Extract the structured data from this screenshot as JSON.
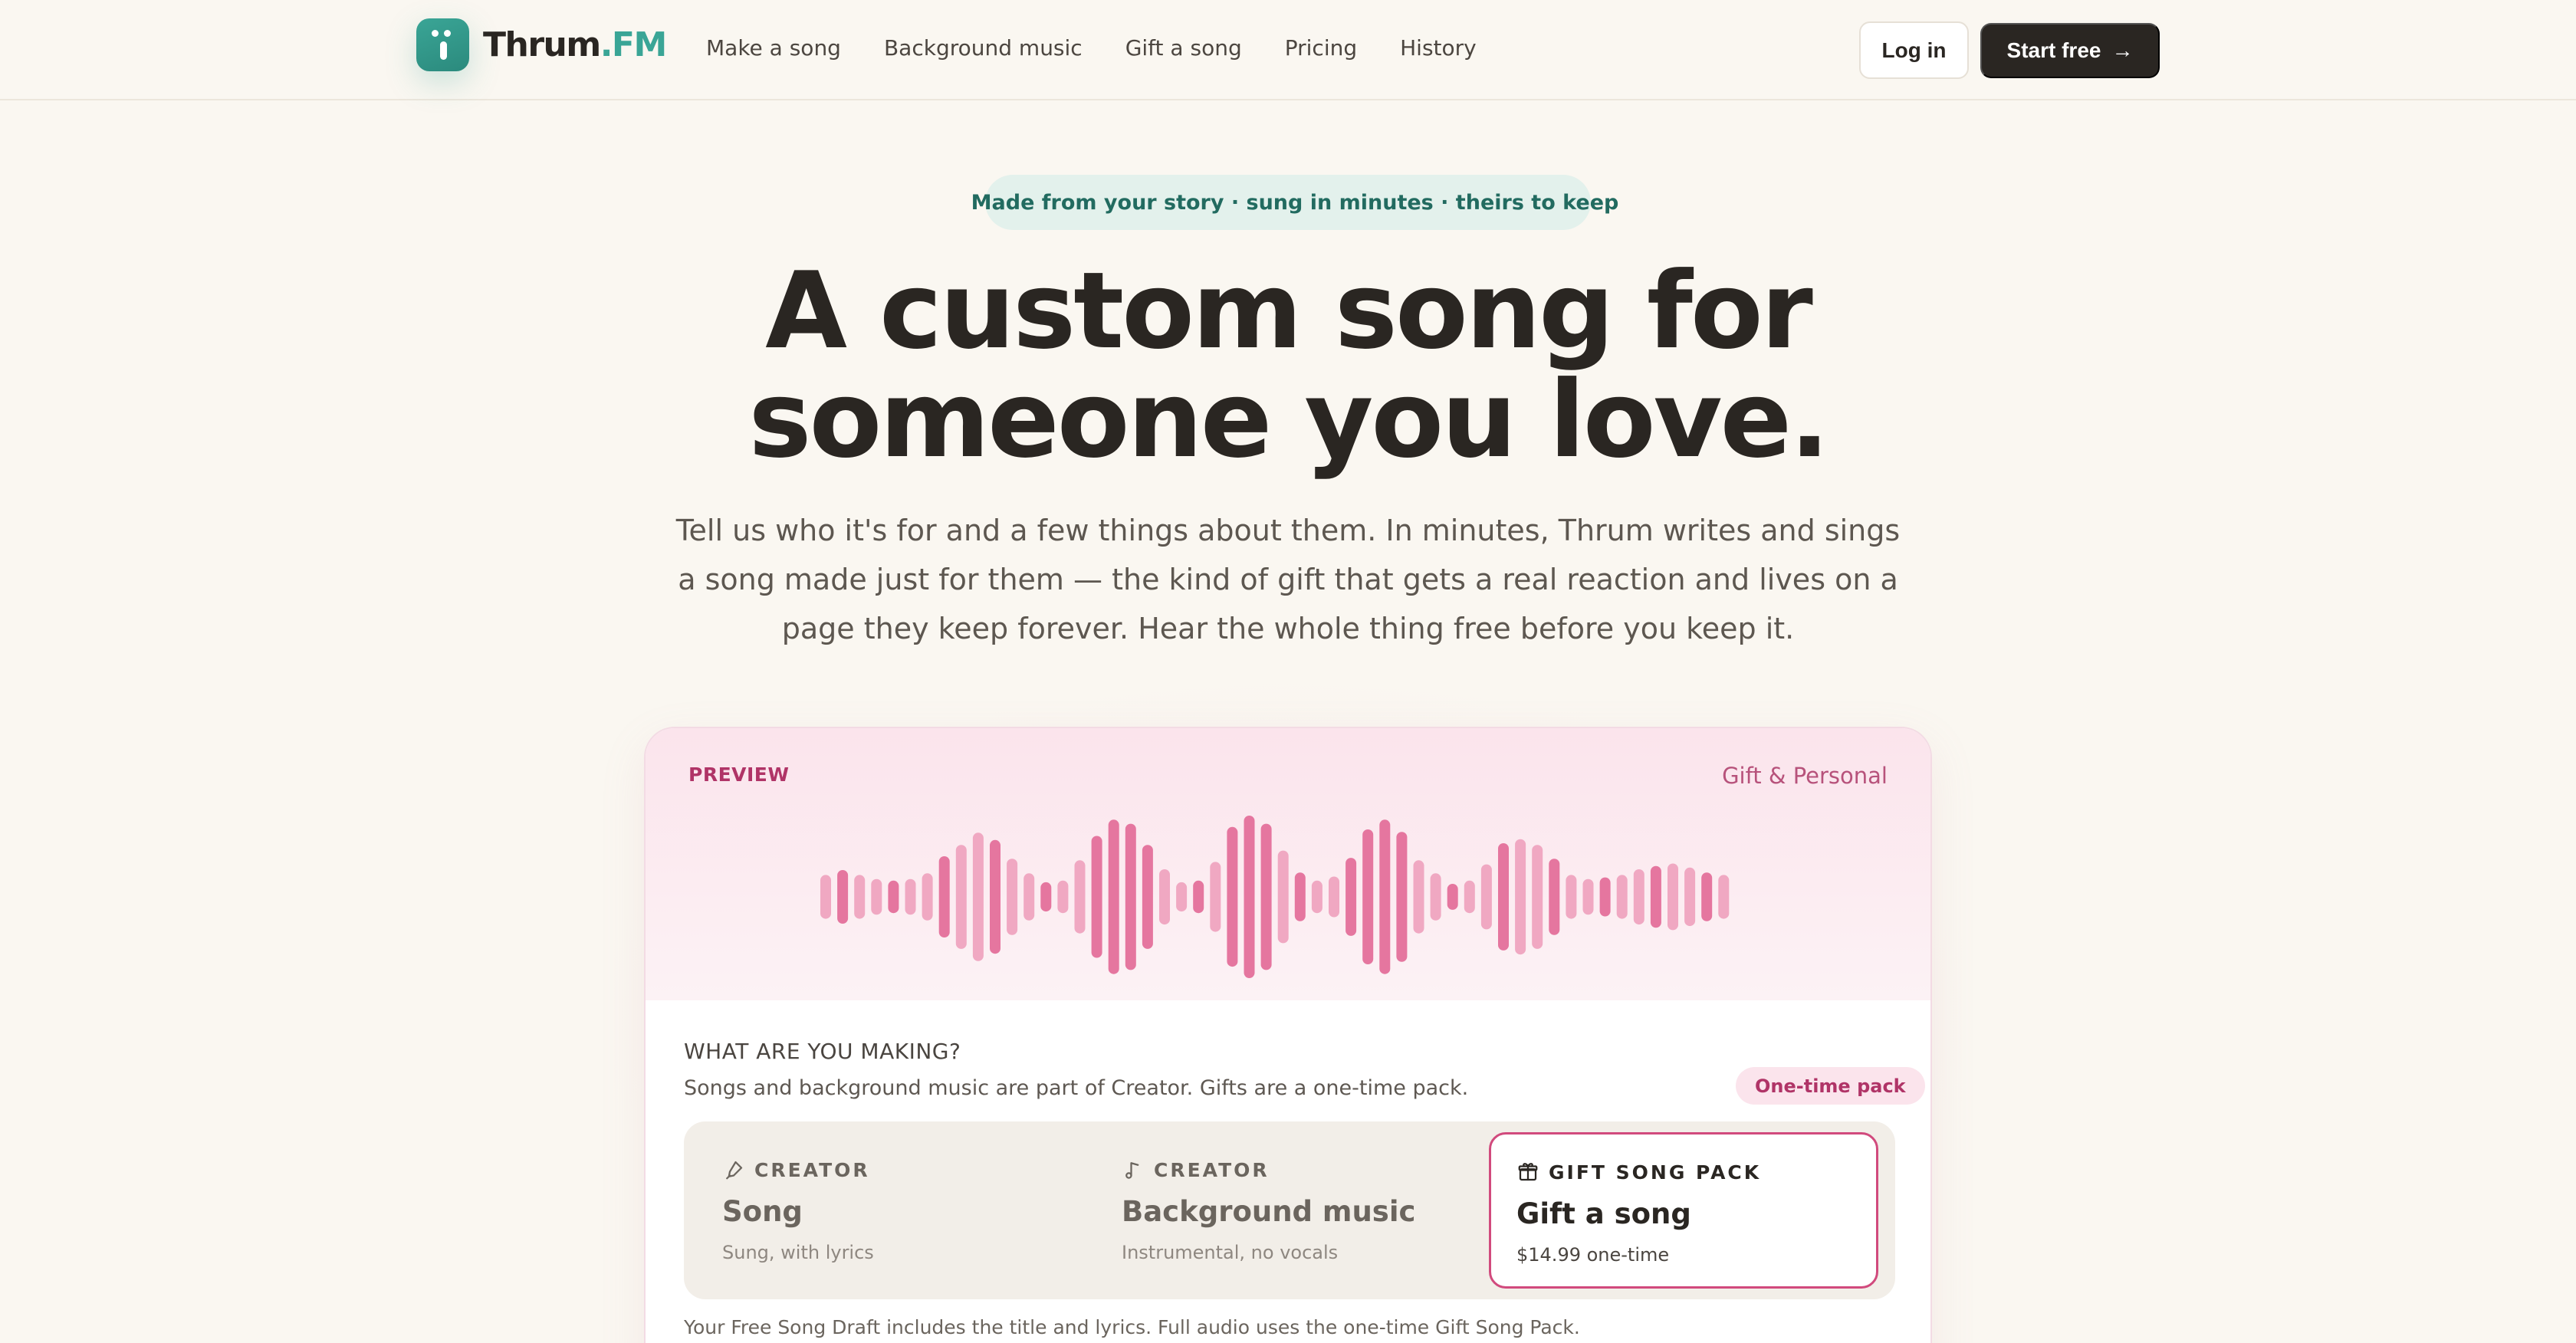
{
  "nav": {
    "brand_main": "Thrum",
    "brand_suffix": ".FM",
    "links": [
      "Make a song",
      "Background music",
      "Gift a song",
      "Pricing",
      "History"
    ],
    "login_label": "Log in",
    "start_label": "Start free"
  },
  "hero": {
    "pill_text": "Made from your story · sung in minutes · theirs to keep",
    "headline_line1": "A custom song for",
    "headline_line2": "someone you love.",
    "subtext": "Tell us who it's for and a few things about them. In minutes, Thrum writes and sings a song made just for them — the kind of gift that gets a real reaction and lives on a page they keep forever. Hear the whole thing free before you keep it."
  },
  "card": {
    "preview_label": "PREVIEW",
    "category_label": "Gift & Personal",
    "waveform": {
      "colors": [
        "#f0a8c2",
        "#e5769f"
      ],
      "levels": [
        0.27,
        0.33,
        0.27,
        0.22,
        0.2,
        0.22,
        0.29,
        0.5,
        0.64,
        0.79,
        0.7,
        0.47,
        0.29,
        0.18,
        0.2,
        0.45,
        0.75,
        0.95,
        0.9,
        0.64,
        0.34,
        0.18,
        0.2,
        0.43,
        0.86,
        1.0,
        0.9,
        0.57,
        0.3,
        0.2,
        0.25,
        0.48,
        0.83,
        0.95,
        0.8,
        0.45,
        0.29,
        0.16,
        0.2,
        0.4,
        0.66,
        0.71,
        0.64,
        0.47,
        0.27,
        0.22,
        0.24,
        0.27,
        0.34,
        0.38,
        0.41,
        0.36,
        0.3,
        0.27
      ]
    },
    "making_title": "WHAT ARE YOU MAKING?",
    "making_sub": "Songs and background music are part of Creator. Gifts are a one-time pack.",
    "badge": "One-time pack",
    "options": [
      {
        "kicker": "CREATOR",
        "title": "Song",
        "desc": "Sung, with lyrics",
        "icon": "microphone-icon"
      },
      {
        "kicker": "CREATOR",
        "title": "Background music",
        "desc": "Instrumental, no vocals",
        "icon": "music-note-icon"
      },
      {
        "kicker": "GIFT SONG PACK",
        "title": "Gift a song",
        "desc": "$14.99 one-time",
        "icon": "gift-icon"
      }
    ],
    "footnote": "Your Free Song Draft includes the title and lyrics. Full audio uses the one-time Gift Song Pack."
  }
}
